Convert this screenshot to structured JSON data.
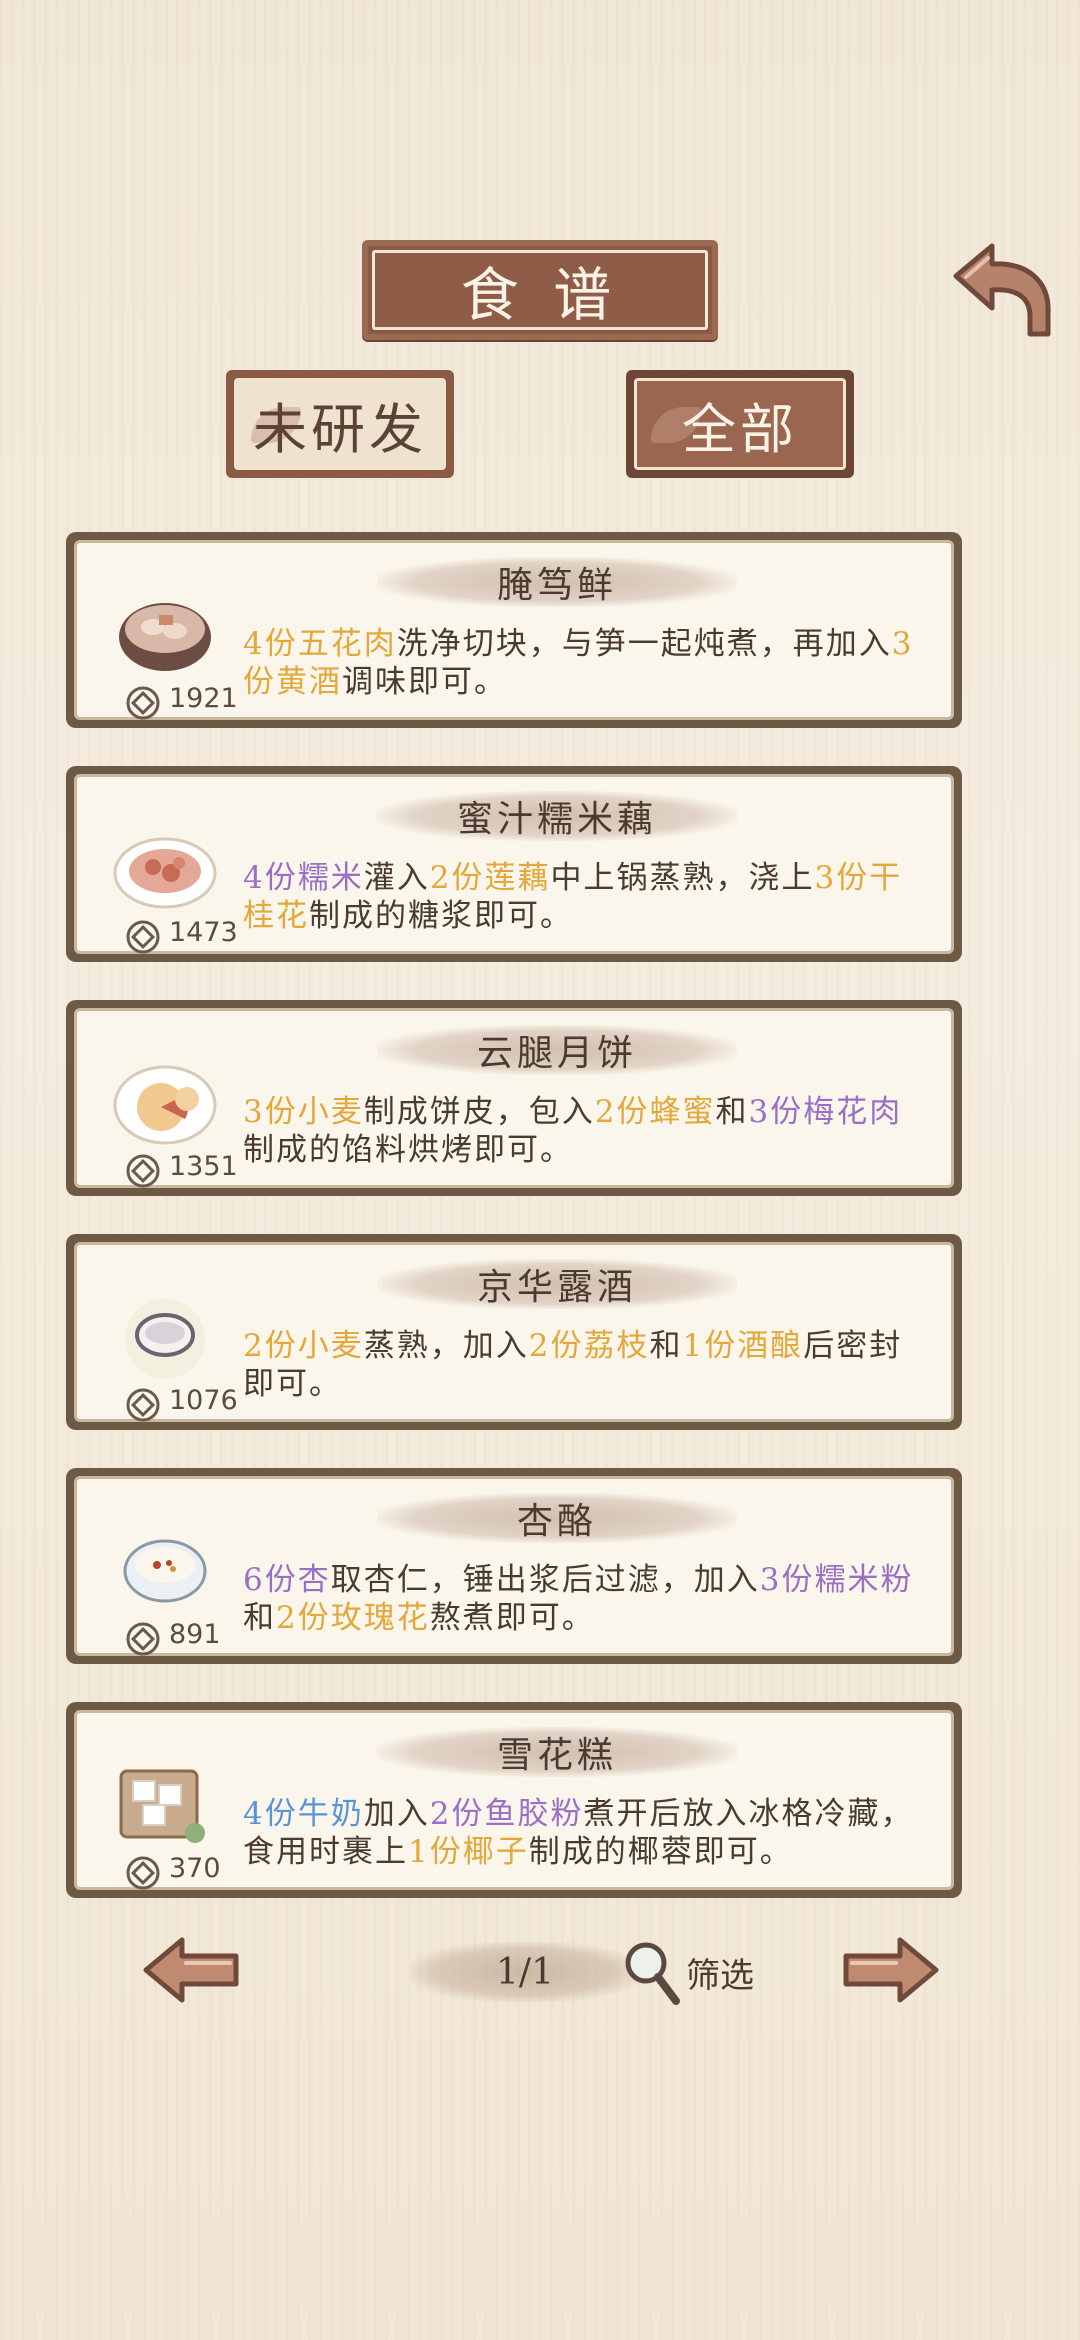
{
  "header": {
    "title": "食 谱",
    "back_icon": "curved-back-arrow-icon"
  },
  "tabs": [
    {
      "label": "未研发",
      "selected": false
    },
    {
      "label": "全部",
      "selected": true
    }
  ],
  "recipes": [
    {
      "name": "腌笃鲜",
      "price": "1921",
      "dish_icon": "pot-stew-icon",
      "desc": [
        {
          "t": "4份五花肉",
          "c": "y"
        },
        {
          "t": "洗净切块，与笋一起炖煮，再加入",
          "c": ""
        },
        {
          "t": "3份黄酒",
          "c": "y"
        },
        {
          "t": "调味即可。",
          "c": ""
        }
      ]
    },
    {
      "name": "蜜汁糯米藕",
      "price": "1473",
      "dish_icon": "lotus-root-plate-icon",
      "desc": [
        {
          "t": "4份糯米",
          "c": "p"
        },
        {
          "t": "灌入",
          "c": ""
        },
        {
          "t": "2份莲藕",
          "c": "y"
        },
        {
          "t": "中上锅蒸熟，浇上",
          "c": ""
        },
        {
          "t": "3份干桂花",
          "c": "y"
        },
        {
          "t": "制成的糖浆即可。",
          "c": ""
        }
      ]
    },
    {
      "name": "云腿月饼",
      "price": "1351",
      "dish_icon": "mooncake-plate-icon",
      "desc": [
        {
          "t": "3份小麦",
          "c": "y"
        },
        {
          "t": "制成饼皮，包入",
          "c": ""
        },
        {
          "t": "2份蜂蜜",
          "c": "y"
        },
        {
          "t": "和",
          "c": ""
        },
        {
          "t": "3份梅花肉",
          "c": "p"
        },
        {
          "t": "制成的馅料烘烤即可。",
          "c": ""
        }
      ]
    },
    {
      "name": "京华露酒",
      "price": "1076",
      "dish_icon": "wine-cup-icon",
      "desc": [
        {
          "t": "2份小麦",
          "c": "y"
        },
        {
          "t": "蒸熟，加入",
          "c": ""
        },
        {
          "t": "2份荔枝",
          "c": "y"
        },
        {
          "t": "和",
          "c": ""
        },
        {
          "t": "1份酒酿",
          "c": "y"
        },
        {
          "t": "后密封即可。",
          "c": ""
        }
      ]
    },
    {
      "name": "杏酪",
      "price": "891",
      "dish_icon": "almond-pudding-bowl-icon",
      "desc": [
        {
          "t": "6份杏",
          "c": "p"
        },
        {
          "t": "取杏仁，锤出浆后过滤，加入",
          "c": ""
        },
        {
          "t": "3份糯米粉",
          "c": "p"
        },
        {
          "t": "和",
          "c": ""
        },
        {
          "t": "2份玫瑰花",
          "c": "y"
        },
        {
          "t": "熬煮即可。",
          "c": ""
        }
      ]
    },
    {
      "name": "雪花糕",
      "price": "370",
      "dish_icon": "snow-cake-board-icon",
      "desc": [
        {
          "t": "4份牛奶",
          "c": "b"
        },
        {
          "t": "加入",
          "c": ""
        },
        {
          "t": "2份鱼胶粉",
          "c": "p"
        },
        {
          "t": "煮开后放入冰格冷藏，食用时裹上",
          "c": ""
        },
        {
          "t": "1份椰子",
          "c": "y"
        },
        {
          "t": "制成的椰蓉即可。",
          "c": ""
        }
      ]
    }
  ],
  "pagination": {
    "page": "1/1",
    "filter_label": "筛选",
    "prev_icon": "left-arrow-icon",
    "next_icon": "right-arrow-icon",
    "filter_icon": "magnifier-icon"
  },
  "colors": {
    "plaque": "#8f5d47",
    "highlight_yellow": "#e4a73a",
    "highlight_purple": "#9a6fc6",
    "highlight_blue": "#5b93d8"
  }
}
